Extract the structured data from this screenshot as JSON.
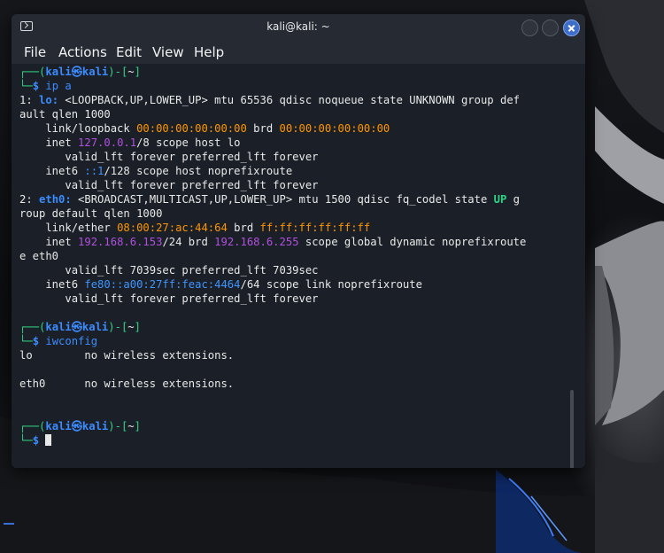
{
  "window": {
    "title": "kali@kali: ~"
  },
  "menu": [
    "File",
    "Actions",
    "Edit",
    "View",
    "Help"
  ],
  "prompt": {
    "left": "┌──(",
    "user": "kali",
    "at": "㉿",
    "host": "kali",
    "bracket_open": ")-[",
    "dir": "~",
    "bracket_close": "]",
    "bottom": "└─",
    "dollar": "$"
  },
  "commands": {
    "cmd1": "ip a",
    "cmd2": "iwconfig"
  },
  "output": {
    "lo_1a": "1: ",
    "lo_1b": "lo:",
    "lo_1c": " <LOOPBACK,UP,LOWER_UP> mtu 65536 qdisc noqueue state UNKNOWN group def",
    "lo_2": "ault qlen 1000",
    "lo_3a": "    link/loopback ",
    "lo_3b": "00:00:00:00:00:00",
    "lo_3c": " brd ",
    "lo_3d": "00:00:00:00:00:00",
    "lo_4a": "    inet ",
    "lo_4b": "127.0.0.1",
    "lo_4c": "/8 scope host lo",
    "lo_5": "       valid_lft forever preferred_lft forever",
    "lo_6a": "    inet6 ",
    "lo_6b": "::1",
    "lo_6c": "/128 scope host noprefixroute",
    "lo_7": "       valid_lft forever preferred_lft forever",
    "eth_1a": "2: ",
    "eth_1b": "eth0:",
    "eth_1c": " <BROADCAST,MULTICAST,UP,LOWER_UP> mtu 1500 qdisc fq_codel state ",
    "eth_1d": "UP",
    "eth_1e": " g",
    "eth_2": "roup default qlen 1000",
    "eth_3a": "    link/ether ",
    "eth_3b": "08:00:27:ac:44:64",
    "eth_3c": " brd ",
    "eth_3d": "ff:ff:ff:ff:ff:ff",
    "eth_4a": "    inet ",
    "eth_4b": "192.168.6.153",
    "eth_4c": "/24 brd ",
    "eth_4d": "192.168.6.255",
    "eth_4e": " scope global dynamic noprefixroute",
    "eth_5": "e eth0",
    "eth_6": "       valid_lft 7039sec preferred_lft 7039sec",
    "eth_7a": "    inet6 ",
    "eth_7b": "fe80::a00:27ff:feac:4464",
    "eth_7c": "/64 scope link noprefixroute",
    "eth_8": "       valid_lft forever preferred_lft forever",
    "iw_lo": "lo        no wireless extensions.",
    "iw_eth0": "eth0      no wireless extensions."
  },
  "icons": [
    "terminal-icon",
    "minimize-button",
    "maximize-button",
    "close-icon"
  ],
  "colors": {
    "accent": "#3b8cff",
    "state_up": "#2fd386",
    "mac": "#ff9500",
    "ip": "#b14fe0",
    "close_button": "#3f6ec9"
  }
}
